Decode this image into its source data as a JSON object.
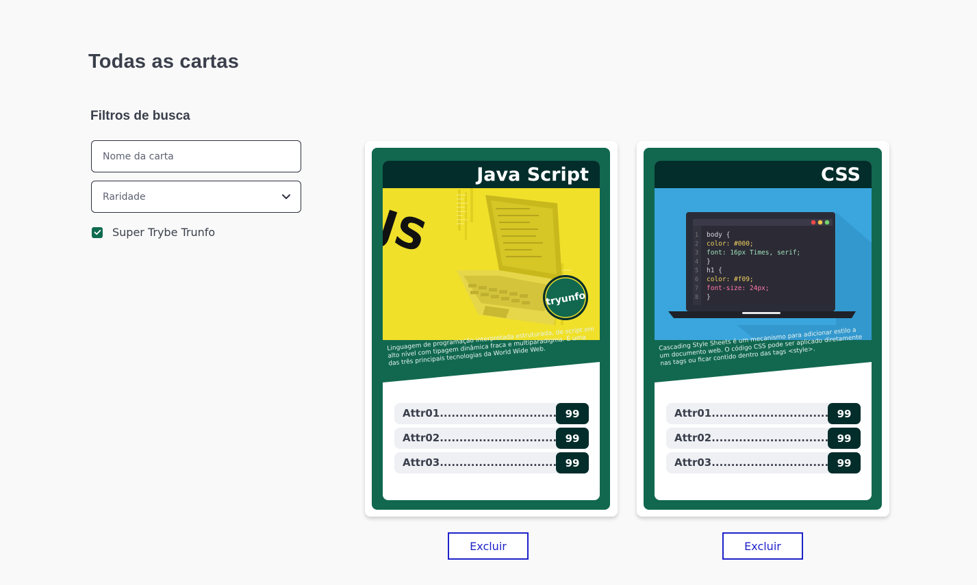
{
  "page": {
    "title": "Todas as cartas"
  },
  "filters": {
    "title": "Filtros de busca",
    "name_placeholder": "Nome da carta",
    "rarity_selected": "Raridade",
    "trunfo_label": "Super Trybe Trunfo",
    "trunfo_checked": true
  },
  "cards": [
    {
      "name": "Java Script",
      "image_badge": "tryunfo",
      "description": "Linguagem de programação interpretada estruturada, de script em alto nível com tipagem dinâmica fraca e multiparadigma. É uma das três principais tecnologias da World Wide Web.",
      "attrs": [
        {
          "name": "Attr01..................................",
          "value": "99"
        },
        {
          "name": "Attr02..................................",
          "value": "99"
        },
        {
          "name": "Attr03..................................",
          "value": "99"
        }
      ],
      "delete_label": "Excluir"
    },
    {
      "name": "CSS",
      "code_lines": [
        {
          "num": "1",
          "text": "body {"
        },
        {
          "num": "2",
          "text": "  color: #000;"
        },
        {
          "num": "3",
          "text": "  font: 16px Times, serif;"
        },
        {
          "num": "4",
          "text": "}"
        },
        {
          "num": "5",
          "text": "h1 {"
        },
        {
          "num": "6",
          "text": "  color: #f09;"
        },
        {
          "num": "7",
          "text": "  font-size: 24px;"
        },
        {
          "num": "8",
          "text": "}"
        }
      ],
      "description": "Cascading Style Sheets é um mecanismo para adicionar estilo a um documento web. O código CSS pode ser aplicado diretamente nas tags ou ficar contido dentro das tags <style>.",
      "attrs": [
        {
          "name": "Attr01..................................",
          "value": "99"
        },
        {
          "name": "Attr02..................................",
          "value": "99"
        },
        {
          "name": "Attr03..................................",
          "value": "99"
        }
      ],
      "delete_label": "Excluir"
    }
  ],
  "colors": {
    "card_green": "#11684f",
    "card_dark": "#022d2b",
    "js_yellow": "#f0e02a",
    "css_blue": "#3aa6dd",
    "delete_blue": "#1e22c8"
  }
}
